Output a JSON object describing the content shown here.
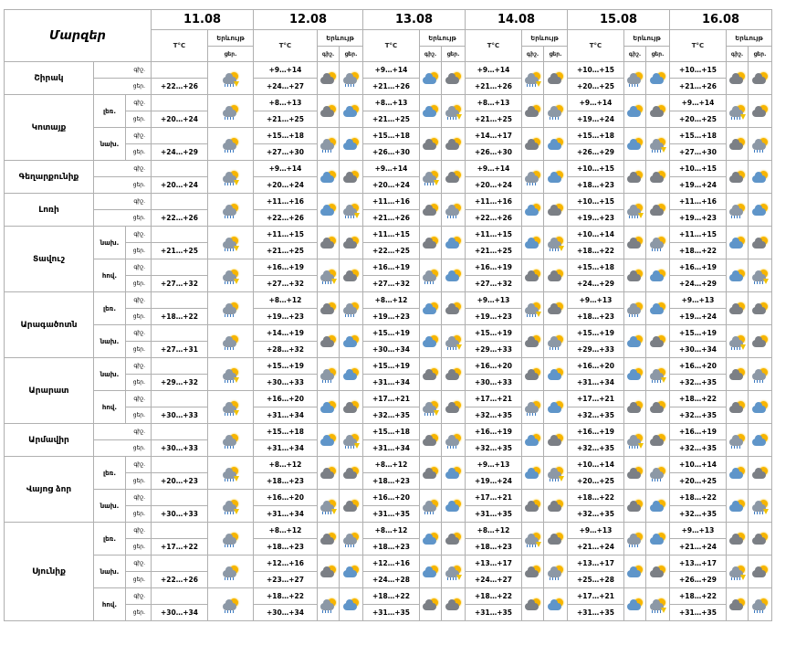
{
  "header": {
    "region_title": "Մարզեր",
    "temp_label": "T°C",
    "weather_label": "Երևույթ",
    "night_label": "գիշ.",
    "day_label": "ցեր.",
    "dates": [
      "11.08",
      "12.08",
      "13.08",
      "14.08",
      "15.08",
      "16.08"
    ]
  },
  "regions": [
    {
      "name": "Շիրակ",
      "subs": [
        {
          "label": "",
          "night": [
            "",
            "+9…+14",
            "+9…+14",
            "+9…+14",
            "+10…+15",
            "+10…+15"
          ],
          "day": [
            "+22…+26",
            "+24…+27",
            "+21…+26",
            "+21…+26",
            "+20…+25",
            "+21…+26"
          ]
        }
      ]
    },
    {
      "name": "Կոտայք",
      "subs": [
        {
          "label": "լեռ.",
          "night": [
            "",
            "+8…+13",
            "+8…+13",
            "+8…+13",
            "+9…+14",
            "+9…+14"
          ],
          "day": [
            "+20…+24",
            "+21…+25",
            "+21…+25",
            "+21…+25",
            "+19…+24",
            "+20…+25"
          ]
        },
        {
          "label": "նախ.",
          "night": [
            "",
            "+15…+18",
            "+15…+18",
            "+14…+17",
            "+15…+18",
            "+15…+18"
          ],
          "day": [
            "+24…+29",
            "+27…+30",
            "+26…+30",
            "+26…+30",
            "+26…+29",
            "+27…+30"
          ]
        }
      ]
    },
    {
      "name": "Գեղարքունիք",
      "subs": [
        {
          "label": "",
          "night": [
            "",
            "+9…+14",
            "+9…+14",
            "+9…+14",
            "+10…+15",
            "+10…+15"
          ],
          "day": [
            "+20…+24",
            "+20…+24",
            "+20…+24",
            "+20…+24",
            "+18…+23",
            "+19…+24"
          ]
        }
      ]
    },
    {
      "name": "Լոռի",
      "subs": [
        {
          "label": "",
          "night": [
            "",
            "+11…+16",
            "+11…+16",
            "+11…+16",
            "+10…+15",
            "+11…+16"
          ],
          "day": [
            "+22…+26",
            "+22…+26",
            "+21…+26",
            "+22…+26",
            "+19…+23",
            "+19…+23"
          ]
        }
      ]
    },
    {
      "name": "Տավուշ",
      "subs": [
        {
          "label": "նախ.",
          "night": [
            "",
            "+11…+15",
            "+11…+15",
            "+11…+15",
            "+10…+14",
            "+11…+15"
          ],
          "day": [
            "+21…+25",
            "+21…+25",
            "+22…+25",
            "+21…+25",
            "+18…+22",
            "+18…+22"
          ]
        },
        {
          "label": "հով.",
          "night": [
            "",
            "+16…+19",
            "+16…+19",
            "+16…+19",
            "+15…+18",
            "+16…+19"
          ],
          "day": [
            "+27…+32",
            "+27…+32",
            "+27…+32",
            "+27…+32",
            "+24…+29",
            "+24…+29"
          ]
        }
      ]
    },
    {
      "name": "Արագածոտն",
      "subs": [
        {
          "label": "լեռ.",
          "night": [
            "",
            "+8…+12",
            "+8…+12",
            "+9…+13",
            "+9…+13",
            "+9…+13"
          ],
          "day": [
            "+18…+22",
            "+19…+23",
            "+19…+23",
            "+19…+23",
            "+18…+23",
            "+19…+24"
          ]
        },
        {
          "label": "նախ.",
          "night": [
            "",
            "+14…+19",
            "+15…+19",
            "+15…+19",
            "+15…+19",
            "+15…+19"
          ],
          "day": [
            "+27…+31",
            "+28…+32",
            "+30…+34",
            "+29…+33",
            "+29…+33",
            "+30…+34"
          ]
        }
      ]
    },
    {
      "name": "Արարատ",
      "subs": [
        {
          "label": "նախ.",
          "night": [
            "",
            "+15…+19",
            "+15…+19",
            "+16…+20",
            "+16…+20",
            "+16…+20"
          ],
          "day": [
            "+29…+32",
            "+30…+33",
            "+31…+34",
            "+30…+33",
            "+31…+34",
            "+32…+35"
          ]
        },
        {
          "label": "հով.",
          "night": [
            "",
            "+16…+20",
            "+17…+21",
            "+17…+21",
            "+17…+21",
            "+18…+22"
          ],
          "day": [
            "+30…+33",
            "+31…+34",
            "+32…+35",
            "+32…+35",
            "+32…+35",
            "+32…+35"
          ]
        }
      ]
    },
    {
      "name": "Արմավիր",
      "subs": [
        {
          "label": "",
          "night": [
            "",
            "+15…+18",
            "+15…+18",
            "+16…+19",
            "+16…+19",
            "+16…+19"
          ],
          "day": [
            "+30…+33",
            "+31…+34",
            "+31…+34",
            "+32…+35",
            "+32…+35",
            "+32…+35"
          ]
        }
      ]
    },
    {
      "name": "Վայոց ձոր",
      "subs": [
        {
          "label": "լեռ.",
          "night": [
            "",
            "+8…+12",
            "+8…+12",
            "+9…+13",
            "+10…+14",
            "+10…+14"
          ],
          "day": [
            "+20…+23",
            "+18…+23",
            "+18…+23",
            "+19…+24",
            "+20…+25",
            "+20…+25"
          ]
        },
        {
          "label": "նախ.",
          "night": [
            "",
            "+16…+20",
            "+16…+20",
            "+17…+21",
            "+18…+22",
            "+18…+22"
          ],
          "day": [
            "+30…+33",
            "+31…+34",
            "+31…+35",
            "+31…+35",
            "+32…+35",
            "+32…+35"
          ]
        }
      ]
    },
    {
      "name": "Սյունիք",
      "subs": [
        {
          "label": "լեռ.",
          "night": [
            "",
            "+8…+12",
            "+8…+12",
            "+8…+12",
            "+9…+13",
            "+9…+13"
          ],
          "day": [
            "+17…+22",
            "+18…+23",
            "+18…+23",
            "+18…+23",
            "+21…+24",
            "+21…+24"
          ]
        },
        {
          "label": "նախ.",
          "night": [
            "",
            "+12…+16",
            "+12…+16",
            "+13…+17",
            "+13…+17",
            "+13…+17"
          ],
          "day": [
            "+22…+26",
            "+23…+27",
            "+24…+28",
            "+24…+27",
            "+25…+28",
            "+26…+29"
          ]
        },
        {
          "label": "հով.",
          "night": [
            "",
            "+18…+22",
            "+18…+22",
            "+18…+22",
            "+17…+21",
            "+18…+22"
          ],
          "day": [
            "+30…+34",
            "+30…+34",
            "+31…+35",
            "+31…+35",
            "+31…+35",
            "+31…+35"
          ]
        }
      ]
    }
  ],
  "icon_types": {
    "g": "sun-rain-cloud-icon",
    "t": "sun-storm-cloud-icon",
    "c": "partly-cloudy-icon",
    "b": "sun-blue-cloud-icon",
    "d": "dark-cloud-sun-icon"
  }
}
